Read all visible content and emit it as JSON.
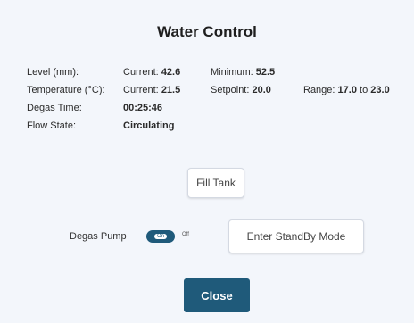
{
  "dialog": {
    "title": "Water Control"
  },
  "level": {
    "label": "Level (mm):",
    "current_label": "Current:",
    "current": "42.6",
    "minimum_label": "Minimum:",
    "minimum": "52.5"
  },
  "temperature": {
    "label": "Temperature (°C):",
    "current_label": "Current:",
    "current": "21.5",
    "setpoint_label": "Setpoint:",
    "setpoint": "20.0",
    "range_label": "Range:",
    "range_min": "17.0",
    "range_to": "to",
    "range_max": "23.0"
  },
  "degas_time": {
    "label": "Degas Time:",
    "value": "00:25:46"
  },
  "flow_state": {
    "label": "Flow State:",
    "value": "Circulating"
  },
  "buttons": {
    "fill_tank": "Fill Tank",
    "enter_standby": "Enter StandBy Mode",
    "close": "Close"
  },
  "degas_pump": {
    "label": "Degas Pump",
    "on_label": "On",
    "off_label": "Off",
    "state": "On"
  },
  "colors": {
    "accent": "#1f5a7a",
    "background": "#f3f6fb"
  }
}
